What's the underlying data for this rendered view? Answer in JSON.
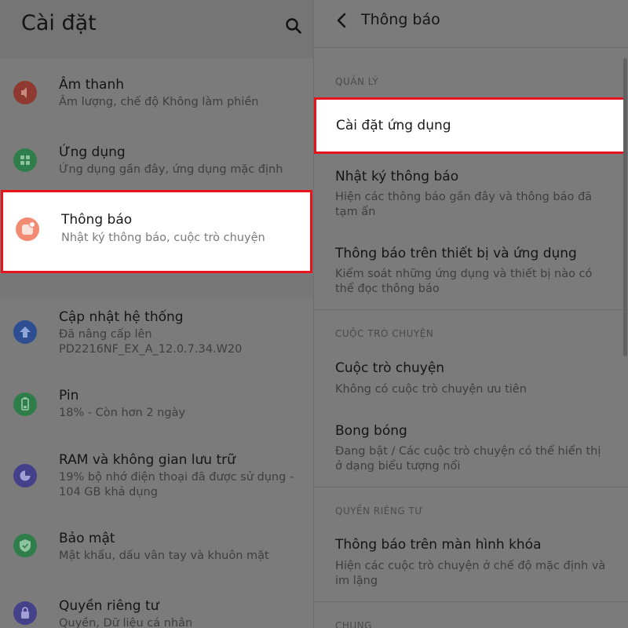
{
  "left": {
    "title": "Cài đặt",
    "items": [
      {
        "title": "Âm thanh",
        "sub": "Âm lượng, chế độ Không làm phiền",
        "icon": "sound-icon",
        "color": "#8e3a30"
      },
      {
        "title": "Ứng dụng",
        "sub": "Ứng dụng gần đây, ứng dụng mặc định",
        "icon": "apps-icon",
        "color": "#2f7d49"
      },
      {
        "title": "Thông báo",
        "sub": "Nhật ký thông báo, cuộc trò chuyện",
        "icon": "notification-icon",
        "color": "#f38a72"
      },
      {
        "title": "Cập nhật hệ thống",
        "sub": "Đã nâng cấp lên",
        "sub2": "PD2216NF_EX_A_12.0.7.34.W20",
        "icon": "update-icon",
        "color": "#2d4f91"
      },
      {
        "title": "Pin",
        "sub": "18% - Còn hơn 2 ngày",
        "icon": "battery-icon",
        "color": "#2f7d49"
      },
      {
        "title": "RAM và không gian lưu trữ",
        "sub": "19% bộ nhớ điện thoại đã được sử dụng -",
        "sub2": "104 GB khả dụng",
        "icon": "storage-icon",
        "color": "#44408a"
      },
      {
        "title": "Bảo mật",
        "sub": "Mật khẩu, dấu vân tay và khuôn mặt",
        "icon": "shield-icon",
        "color": "#2f7d49"
      },
      {
        "title": "Quyền riêng tư",
        "sub": "Quyền, Dữ liệu cá nhân",
        "icon": "privacy-icon",
        "color": "#44408a"
      }
    ]
  },
  "right": {
    "title": "Thông báo",
    "sections": {
      "manage": "QUẢN LÝ",
      "conversations": "CUỘC TRÒ CHUYỆN",
      "privacy": "QUYỀN RIÊNG TƯ",
      "general": "CHUNG"
    },
    "items": {
      "app_settings": {
        "title": "Cài đặt ứng dụng"
      },
      "history": {
        "title": "Nhật ký thông báo",
        "sub": "Hiện các thông báo gần đây và thông báo đã tạm ẩn"
      },
      "device_notif": {
        "title": "Thông báo trên thiết bị và ứng dụng",
        "sub": "Kiểm soát những ứng dụng và thiết bị nào có thể đọc thông báo"
      },
      "conversations": {
        "title": "Cuộc trò chuyện",
        "sub": "Không có cuộc trò chuyện ưu tiên"
      },
      "bubbles": {
        "title": "Bong bóng",
        "sub": "Đang bật / Các cuộc trò chuyện có thể hiển thị ở dạng biểu tượng nổi"
      },
      "lockscreen": {
        "title": "Thông báo trên màn hình khóa",
        "sub": "Hiện các cuộc trò chuyện ở chế độ mặc định và im lặng"
      }
    }
  },
  "colors": {
    "highlight_border": "#e8141c",
    "dim_background": "#7b7b7b"
  }
}
